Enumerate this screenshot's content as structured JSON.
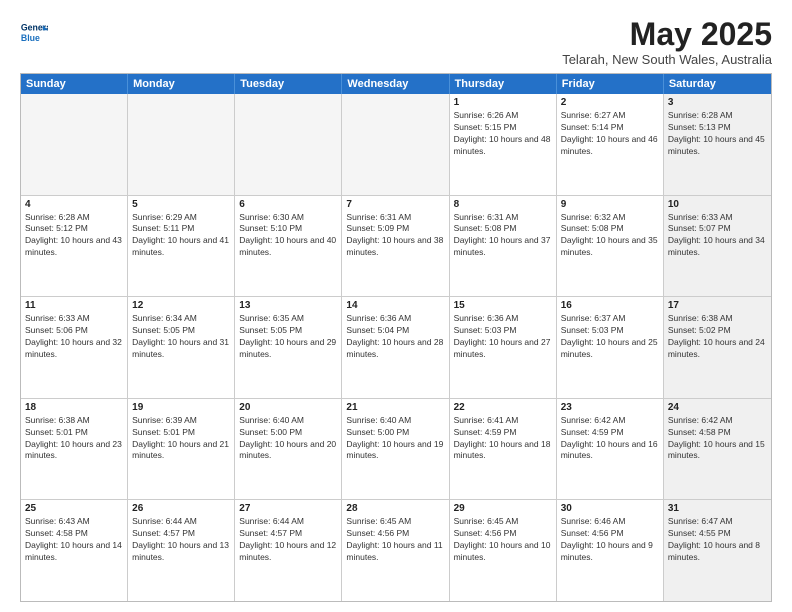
{
  "logo": {
    "line1": "General",
    "line2": "Blue"
  },
  "header": {
    "title": "May 2025",
    "subtitle": "Telarah, New South Wales, Australia"
  },
  "weekdays": [
    "Sunday",
    "Monday",
    "Tuesday",
    "Wednesday",
    "Thursday",
    "Friday",
    "Saturday"
  ],
  "rows": [
    [
      {
        "day": "",
        "empty": true
      },
      {
        "day": "",
        "empty": true
      },
      {
        "day": "",
        "empty": true
      },
      {
        "day": "",
        "empty": true
      },
      {
        "day": "1",
        "sunrise": "Sunrise: 6:26 AM",
        "sunset": "Sunset: 5:15 PM",
        "daylight": "Daylight: 10 hours and 48 minutes."
      },
      {
        "day": "2",
        "sunrise": "Sunrise: 6:27 AM",
        "sunset": "Sunset: 5:14 PM",
        "daylight": "Daylight: 10 hours and 46 minutes."
      },
      {
        "day": "3",
        "sunrise": "Sunrise: 6:28 AM",
        "sunset": "Sunset: 5:13 PM",
        "daylight": "Daylight: 10 hours and 45 minutes.",
        "shaded": true
      }
    ],
    [
      {
        "day": "4",
        "sunrise": "Sunrise: 6:28 AM",
        "sunset": "Sunset: 5:12 PM",
        "daylight": "Daylight: 10 hours and 43 minutes."
      },
      {
        "day": "5",
        "sunrise": "Sunrise: 6:29 AM",
        "sunset": "Sunset: 5:11 PM",
        "daylight": "Daylight: 10 hours and 41 minutes."
      },
      {
        "day": "6",
        "sunrise": "Sunrise: 6:30 AM",
        "sunset": "Sunset: 5:10 PM",
        "daylight": "Daylight: 10 hours and 40 minutes."
      },
      {
        "day": "7",
        "sunrise": "Sunrise: 6:31 AM",
        "sunset": "Sunset: 5:09 PM",
        "daylight": "Daylight: 10 hours and 38 minutes."
      },
      {
        "day": "8",
        "sunrise": "Sunrise: 6:31 AM",
        "sunset": "Sunset: 5:08 PM",
        "daylight": "Daylight: 10 hours and 37 minutes."
      },
      {
        "day": "9",
        "sunrise": "Sunrise: 6:32 AM",
        "sunset": "Sunset: 5:08 PM",
        "daylight": "Daylight: 10 hours and 35 minutes."
      },
      {
        "day": "10",
        "sunrise": "Sunrise: 6:33 AM",
        "sunset": "Sunset: 5:07 PM",
        "daylight": "Daylight: 10 hours and 34 minutes.",
        "shaded": true
      }
    ],
    [
      {
        "day": "11",
        "sunrise": "Sunrise: 6:33 AM",
        "sunset": "Sunset: 5:06 PM",
        "daylight": "Daylight: 10 hours and 32 minutes."
      },
      {
        "day": "12",
        "sunrise": "Sunrise: 6:34 AM",
        "sunset": "Sunset: 5:05 PM",
        "daylight": "Daylight: 10 hours and 31 minutes."
      },
      {
        "day": "13",
        "sunrise": "Sunrise: 6:35 AM",
        "sunset": "Sunset: 5:05 PM",
        "daylight": "Daylight: 10 hours and 29 minutes."
      },
      {
        "day": "14",
        "sunrise": "Sunrise: 6:36 AM",
        "sunset": "Sunset: 5:04 PM",
        "daylight": "Daylight: 10 hours and 28 minutes."
      },
      {
        "day": "15",
        "sunrise": "Sunrise: 6:36 AM",
        "sunset": "Sunset: 5:03 PM",
        "daylight": "Daylight: 10 hours and 27 minutes."
      },
      {
        "day": "16",
        "sunrise": "Sunrise: 6:37 AM",
        "sunset": "Sunset: 5:03 PM",
        "daylight": "Daylight: 10 hours and 25 minutes."
      },
      {
        "day": "17",
        "sunrise": "Sunrise: 6:38 AM",
        "sunset": "Sunset: 5:02 PM",
        "daylight": "Daylight: 10 hours and 24 minutes.",
        "shaded": true
      }
    ],
    [
      {
        "day": "18",
        "sunrise": "Sunrise: 6:38 AM",
        "sunset": "Sunset: 5:01 PM",
        "daylight": "Daylight: 10 hours and 23 minutes."
      },
      {
        "day": "19",
        "sunrise": "Sunrise: 6:39 AM",
        "sunset": "Sunset: 5:01 PM",
        "daylight": "Daylight: 10 hours and 21 minutes."
      },
      {
        "day": "20",
        "sunrise": "Sunrise: 6:40 AM",
        "sunset": "Sunset: 5:00 PM",
        "daylight": "Daylight: 10 hours and 20 minutes."
      },
      {
        "day": "21",
        "sunrise": "Sunrise: 6:40 AM",
        "sunset": "Sunset: 5:00 PM",
        "daylight": "Daylight: 10 hours and 19 minutes."
      },
      {
        "day": "22",
        "sunrise": "Sunrise: 6:41 AM",
        "sunset": "Sunset: 4:59 PM",
        "daylight": "Daylight: 10 hours and 18 minutes."
      },
      {
        "day": "23",
        "sunrise": "Sunrise: 6:42 AM",
        "sunset": "Sunset: 4:59 PM",
        "daylight": "Daylight: 10 hours and 16 minutes."
      },
      {
        "day": "24",
        "sunrise": "Sunrise: 6:42 AM",
        "sunset": "Sunset: 4:58 PM",
        "daylight": "Daylight: 10 hours and 15 minutes.",
        "shaded": true
      }
    ],
    [
      {
        "day": "25",
        "sunrise": "Sunrise: 6:43 AM",
        "sunset": "Sunset: 4:58 PM",
        "daylight": "Daylight: 10 hours and 14 minutes."
      },
      {
        "day": "26",
        "sunrise": "Sunrise: 6:44 AM",
        "sunset": "Sunset: 4:57 PM",
        "daylight": "Daylight: 10 hours and 13 minutes."
      },
      {
        "day": "27",
        "sunrise": "Sunrise: 6:44 AM",
        "sunset": "Sunset: 4:57 PM",
        "daylight": "Daylight: 10 hours and 12 minutes."
      },
      {
        "day": "28",
        "sunrise": "Sunrise: 6:45 AM",
        "sunset": "Sunset: 4:56 PM",
        "daylight": "Daylight: 10 hours and 11 minutes."
      },
      {
        "day": "29",
        "sunrise": "Sunrise: 6:45 AM",
        "sunset": "Sunset: 4:56 PM",
        "daylight": "Daylight: 10 hours and 10 minutes."
      },
      {
        "day": "30",
        "sunrise": "Sunrise: 6:46 AM",
        "sunset": "Sunset: 4:56 PM",
        "daylight": "Daylight: 10 hours and 9 minutes."
      },
      {
        "day": "31",
        "sunrise": "Sunrise: 6:47 AM",
        "sunset": "Sunset: 4:55 PM",
        "daylight": "Daylight: 10 hours and 8 minutes.",
        "shaded": true
      }
    ]
  ]
}
